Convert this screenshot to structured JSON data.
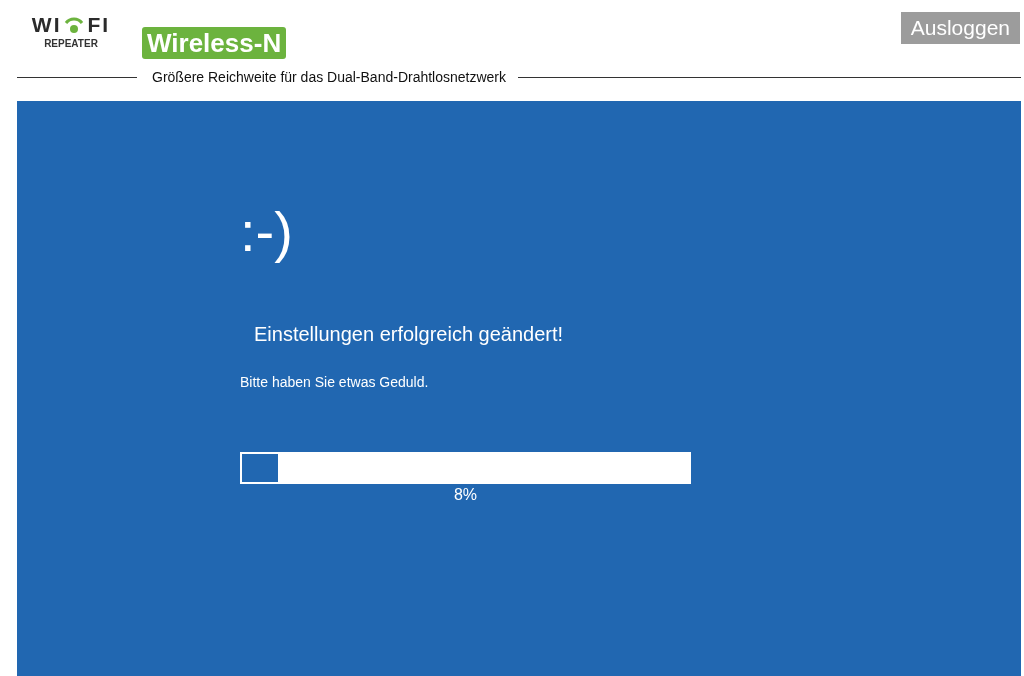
{
  "header": {
    "logo": {
      "left": "WI",
      "right": "FI",
      "sub": "REPEATER"
    },
    "badge": "Wireless-N",
    "tagline": "Größere Reichweite für das Dual-Band-Drahtlosnetzwerk",
    "logout_button": "Ausloggen"
  },
  "panel": {
    "emoticon": ":-)",
    "heading": "Einstellungen erfolgreich geändert!",
    "message": "Bitte haben Sie etwas Geduld.",
    "progress": {
      "level": 0.08,
      "reading": "8%"
    }
  }
}
